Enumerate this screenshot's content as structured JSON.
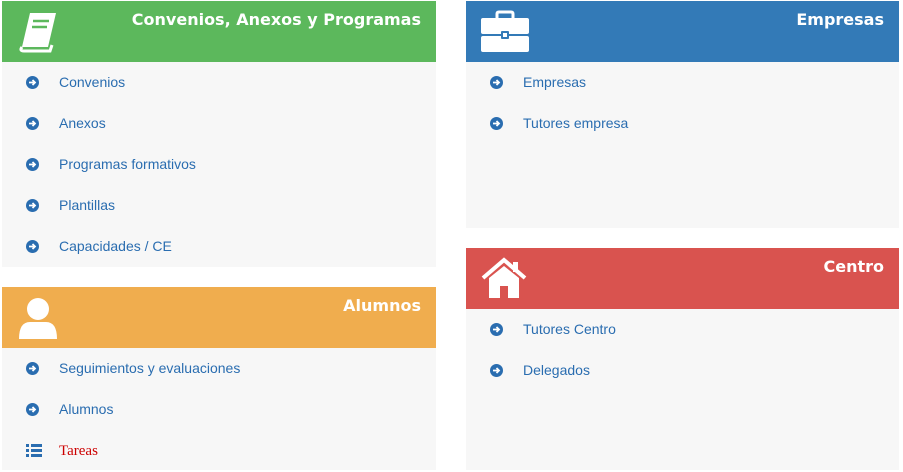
{
  "panels": {
    "convenios": {
      "title": "Convenios, Anexos y Programas",
      "icon": "book-icon",
      "color": "#5cb85c",
      "items": [
        "Convenios",
        "Anexos",
        "Programas formativos",
        "Plantillas",
        "Capacidades / CE"
      ]
    },
    "alumnos": {
      "title": "Alumnos",
      "icon": "user-icon",
      "color": "#f0ad4e",
      "items": [
        "Seguimientos y evaluaciones",
        "Alumnos",
        "Tareas"
      ]
    },
    "empresas": {
      "title": "Empresas",
      "icon": "briefcase-icon",
      "color": "#337ab7",
      "items": [
        "Empresas",
        "Tutores empresa"
      ]
    },
    "centro": {
      "title": "Centro",
      "icon": "home-icon",
      "color": "#d9534f",
      "items": [
        "Tutores Centro",
        "Delegados"
      ]
    }
  },
  "colors": {
    "link": "#2a6db0",
    "tareas_link": "#cc0000",
    "panel_bg": "#f7f7f7"
  },
  "icons": {
    "item_bullet": "arrow-circle-right-icon",
    "tareas_bullet": "list-icon"
  }
}
